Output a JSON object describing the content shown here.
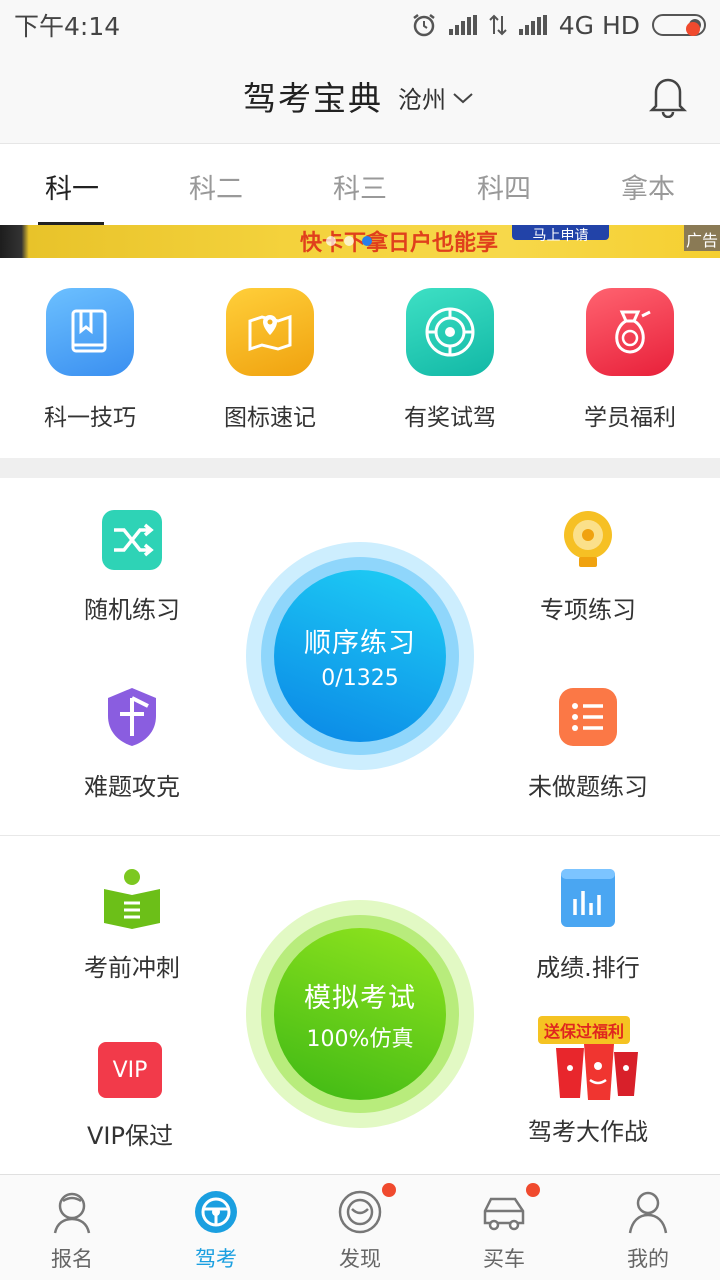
{
  "status_bar": {
    "time": "下午4:14",
    "network": "4G HD"
  },
  "header": {
    "title": "驾考宝典",
    "city": "沧州"
  },
  "tabs": [
    {
      "label": "科一",
      "active": true
    },
    {
      "label": "科二",
      "active": false
    },
    {
      "label": "科三",
      "active": false
    },
    {
      "label": "科四",
      "active": false
    },
    {
      "label": "拿本",
      "active": false
    }
  ],
  "banner": {
    "text": "快卡下拿日户也能享",
    "button": "马上申请",
    "ad": "广告",
    "current_slide": 3,
    "slides": 3
  },
  "quick_links": [
    {
      "label": "科一技巧",
      "icon": "book-icon",
      "color": "#4aa3f0"
    },
    {
      "label": "图标速记",
      "icon": "map-pin-icon",
      "color": "#f5b522"
    },
    {
      "label": "有奖试驾",
      "icon": "steering-target-icon",
      "color": "#1fc9b4"
    },
    {
      "label": "学员福利",
      "icon": "money-bag-icon",
      "color": "#f0374b"
    }
  ],
  "practice": {
    "random": "随机练习",
    "special": "专项练习",
    "hard": "难题攻克",
    "undone": "未做题练习",
    "sequence": {
      "title": "顺序练习",
      "progress": "0/1325"
    }
  },
  "exam": {
    "sprint": "考前冲刺",
    "ranking": "成绩.排行",
    "vip": "VIP保过",
    "vip_badge": "VIP",
    "battle": "驾考大作战",
    "battle_badge": "送保过福利",
    "mock": {
      "title": "模拟考试",
      "sub": "100%仿真"
    }
  },
  "bottom_nav": [
    {
      "label": "报名",
      "icon": "signup-icon",
      "active": false
    },
    {
      "label": "驾考",
      "icon": "steering-wheel-icon",
      "active": true
    },
    {
      "label": "发现",
      "icon": "discover-icon",
      "active": false,
      "dot": true
    },
    {
      "label": "买车",
      "icon": "car-icon",
      "active": false,
      "dot": true
    },
    {
      "label": "我的",
      "icon": "profile-icon",
      "active": false
    }
  ],
  "colors": {
    "accent": "#1a9fe0",
    "badge": "#f04a2e",
    "sequence": "#14a3ef",
    "mock": "#5ec41a"
  }
}
